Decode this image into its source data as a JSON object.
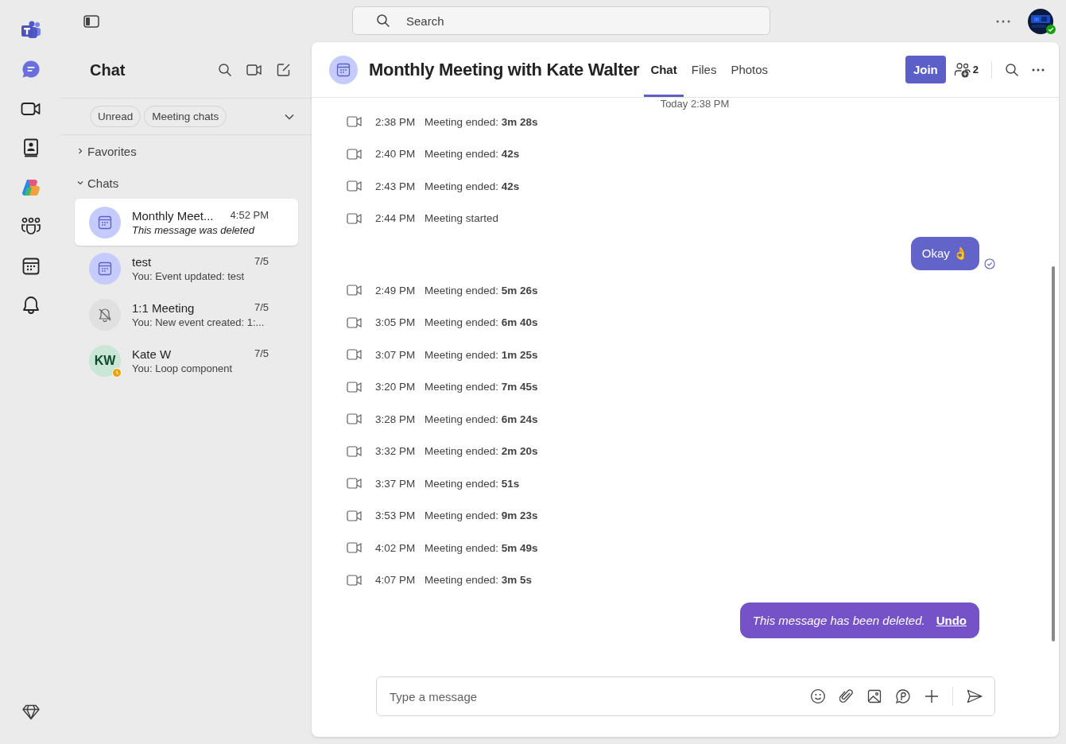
{
  "search": {
    "placeholder": "Search"
  },
  "rail": [
    {
      "kind": "logo"
    },
    {
      "kind": "chat",
      "selected": true
    },
    {
      "kind": "video",
      "selected": false
    },
    {
      "kind": "contacts",
      "selected": false
    },
    {
      "kind": "copilot",
      "selected": false
    },
    {
      "kind": "teams",
      "selected": false
    },
    {
      "kind": "calendar",
      "selected": false
    },
    {
      "kind": "bell",
      "selected": false
    }
  ],
  "chat_panel": {
    "title": "Chat",
    "filters": [
      {
        "label": "Unread",
        "selected": false
      },
      {
        "label": "Meeting chats",
        "selected": false
      }
    ],
    "sections": [
      {
        "label": "Favorites",
        "expanded": false
      },
      {
        "label": "Chats",
        "expanded": true
      }
    ],
    "chats": [
      {
        "name": "Monthly Meet...",
        "time": "4:52 PM",
        "preview": "This message was deleted",
        "deleted": true,
        "kind": "calendar",
        "selected": true
      },
      {
        "name": "test",
        "time": "7/5",
        "preview": "You: Event updated: test",
        "deleted": false,
        "kind": "calendar",
        "selected": false
      },
      {
        "name": "1:1 Meeting",
        "time": "7/5",
        "preview": "You: New event created: 1:...",
        "deleted": false,
        "kind": "muted",
        "selected": false
      },
      {
        "name": "Kate W",
        "time": "7/5",
        "preview": "You: Loop component",
        "deleted": false,
        "kind": "initials",
        "initials": "KW",
        "away": true,
        "selected": false
      }
    ]
  },
  "conversation": {
    "title": "Monthly Meeting with Kate Walter",
    "tabs": [
      {
        "label": "Chat",
        "selected": true
      },
      {
        "label": "Files",
        "selected": false
      },
      {
        "label": "Photos",
        "selected": false
      }
    ],
    "join_label": "Join",
    "participants": "2",
    "date_divider": "Today 2:38 PM",
    "timeline": [
      {
        "kind": "event",
        "time": "2:38 PM",
        "text": "Meeting ended: **3m 28s**"
      },
      {
        "kind": "event",
        "time": "2:40 PM",
        "text": "Meeting ended: **42s**"
      },
      {
        "kind": "event",
        "time": "2:43 PM",
        "text": "Meeting ended: **42s**"
      },
      {
        "kind": "event",
        "time": "2:44 PM",
        "text": "Meeting started"
      },
      {
        "kind": "message",
        "text": "Okay 👌",
        "seen": true
      },
      {
        "kind": "event",
        "time": "2:49 PM",
        "text": "Meeting ended: **5m 26s**"
      },
      {
        "kind": "event",
        "time": "3:05 PM",
        "text": "Meeting ended: **6m 40s**"
      },
      {
        "kind": "event",
        "time": "3:07 PM",
        "text": "Meeting ended: **1m 25s**"
      },
      {
        "kind": "event",
        "time": "3:20 PM",
        "text": "Meeting ended: **7m 45s**"
      },
      {
        "kind": "event",
        "time": "3:28 PM",
        "text": "Meeting ended: **6m 24s**"
      },
      {
        "kind": "event",
        "time": "3:32 PM",
        "text": "Meeting ended: **2m 20s**"
      },
      {
        "kind": "event",
        "time": "3:37 PM",
        "text": "Meeting ended: **51s**"
      },
      {
        "kind": "event",
        "time": "3:53 PM",
        "text": "Meeting ended: **9m 23s**"
      },
      {
        "kind": "event",
        "time": "4:02 PM",
        "text": "Meeting ended: **5m 49s**"
      },
      {
        "kind": "event",
        "time": "4:07 PM",
        "text": "Meeting ended: **3m 5s**"
      },
      {
        "kind": "deleted",
        "text": "This message has been deleted.",
        "action": "Undo"
      }
    ],
    "composer": {
      "placeholder": "Type a message"
    }
  }
}
